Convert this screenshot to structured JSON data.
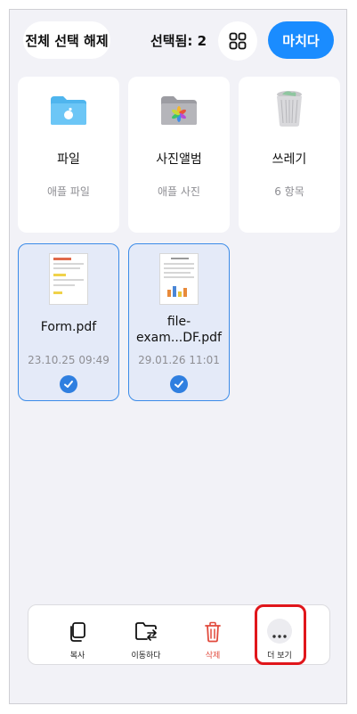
{
  "header": {
    "deselect_all": "전체 선택 해제",
    "selected_count": "선택됨: 2",
    "done": "마치다"
  },
  "items": [
    {
      "title": "파일",
      "subtitle": "애플 파일",
      "icon": "folder-icon"
    },
    {
      "title": "사진앨범",
      "subtitle": "애플 사진",
      "icon": "photos-album-icon"
    },
    {
      "title": "쓰레기",
      "subtitle": "6 항목",
      "icon": "trash-bin-icon"
    },
    {
      "title": "Form.pdf",
      "subtitle": "23.10.25 09:49",
      "selected": true
    },
    {
      "title": "file-\nexam...DF.pdf",
      "subtitle": "29.01.26 11:01",
      "selected": true
    }
  ],
  "toolbar": {
    "copy": "복사",
    "move": "이동하다",
    "delete": "삭제",
    "more": "더 보기"
  },
  "colors": {
    "accent": "#1a8cff",
    "selected_border": "#3b8be8",
    "delete": "#e14a3c",
    "highlight": "#e0161b"
  }
}
